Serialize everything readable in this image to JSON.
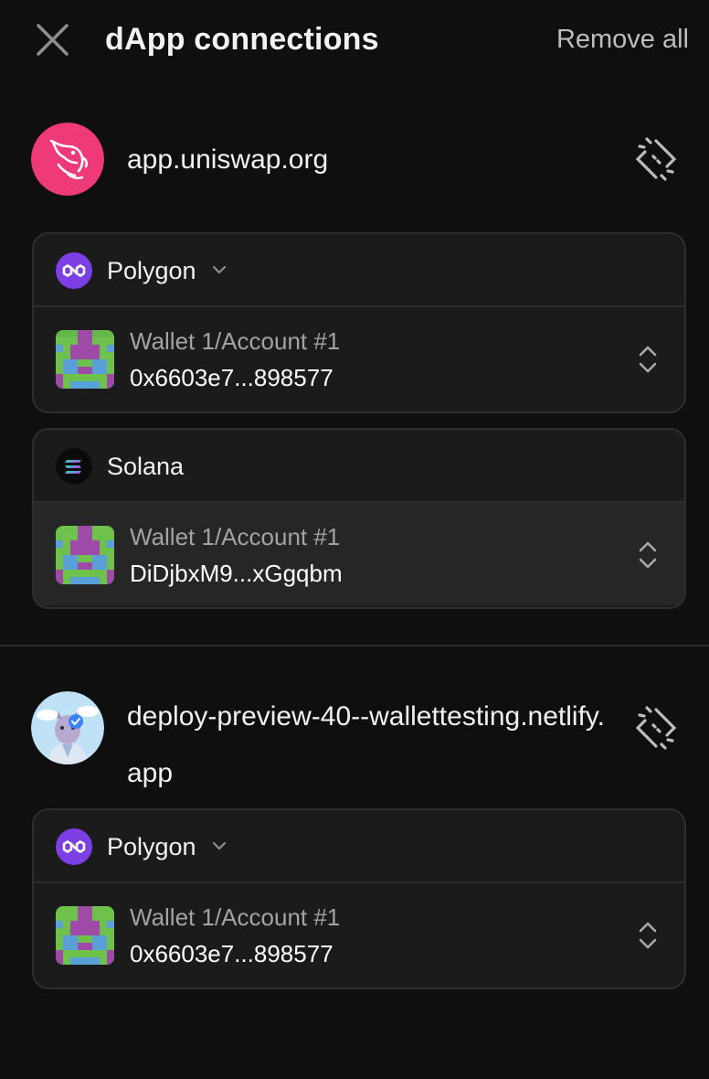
{
  "header": {
    "title": "dApp connections",
    "remove_all_label": "Remove all"
  },
  "dapps": [
    {
      "url": "app.uniswap.org",
      "logo_icon": "uniswap-unicorn-icon",
      "logo_color": "#ee3a78",
      "connections": [
        {
          "chain": "Polygon",
          "chain_icon": "polygon-icon",
          "chain_color": "#7b3fe4",
          "has_dropdown": true,
          "account": {
            "name": "Wallet 1/Account #1",
            "address": "0x6603e7...898577"
          }
        },
        {
          "chain": "Solana",
          "chain_icon": "solana-icon",
          "chain_color": "#0b0b0b",
          "has_dropdown": false,
          "account": {
            "name": "Wallet 1/Account #1",
            "address": "DiDjbxM9...xGgqbm"
          }
        }
      ]
    },
    {
      "url": "deploy-preview-40--wallettesting.netlify.app",
      "logo_icon": "alpaca-avatar-icon",
      "connections": [
        {
          "chain": "Polygon",
          "chain_icon": "polygon-icon",
          "chain_color": "#7b3fe4",
          "has_dropdown": true,
          "account": {
            "name": "Wallet 1/Account #1",
            "address": "0x6603e7...898577"
          }
        }
      ]
    }
  ]
}
